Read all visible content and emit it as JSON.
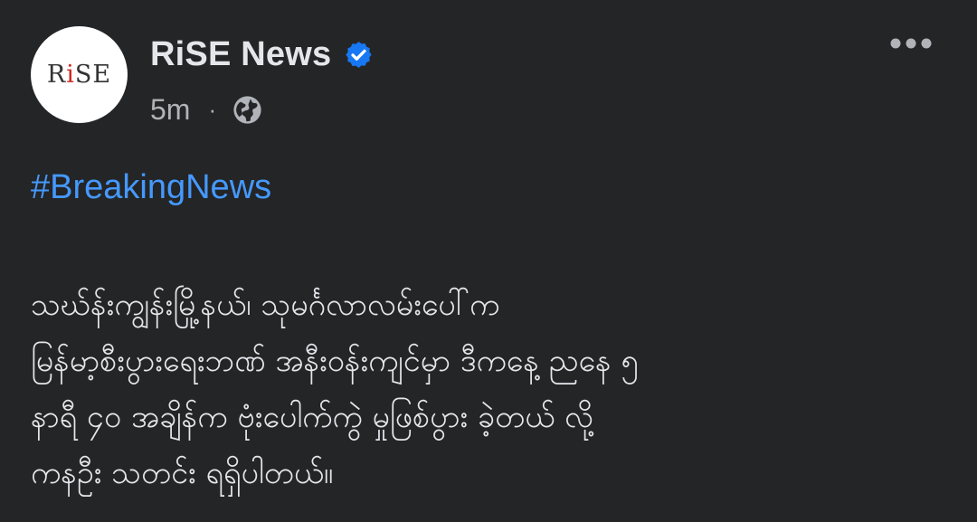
{
  "post": {
    "avatar": {
      "logo_text_r": "R",
      "logo_text_i": "i",
      "logo_text_rest": "SE"
    },
    "page_name": "RiSE News",
    "verified_icon": "verified-badge-icon",
    "timestamp": "5m",
    "separator": "·",
    "audience_icon": "globe-icon",
    "more_icon": "more-options-icon",
    "hashtag": "#BreakingNews",
    "body": "သဃ်န်းကျွန်းမြို့နယ်၊ သုမင်္ဂလာလမ်းပေါ်က\nမြန်မာ့စီးပွားရေးဘဏ် အနီးဝန်းကျင်မှာ ဒီကနေ့ ညနေ ၅\nနာရီ ၄၀ အချိန်က ဗုံးပေါက်ကွဲ မှုဖြစ်ပွား ခဲ့တယ် လို့\nကနဦး သတင်း ရရှိပါတယ်။"
  },
  "colors": {
    "background": "#242526",
    "primary_text": "#e4e6eb",
    "secondary_text": "#b0b3b8",
    "link": "#4599ff",
    "verified_blue": "#1877f2",
    "logo_red": "#d0241e"
  }
}
